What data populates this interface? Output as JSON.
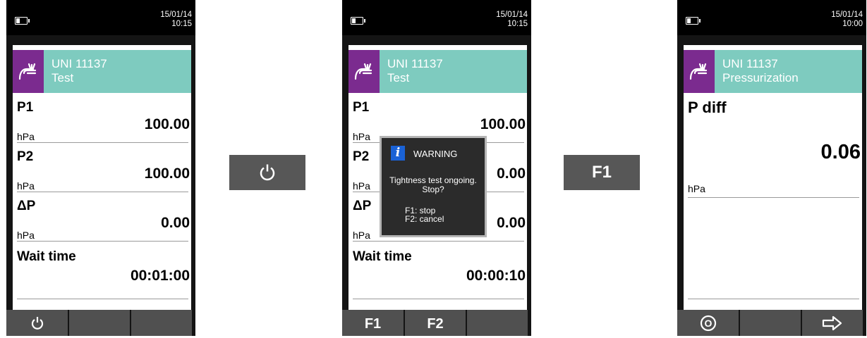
{
  "colors": {
    "header_bg": "#7ecbbf",
    "badge_bg": "#7b2b8f",
    "device_bg": "#141414",
    "key_bg": "#505050",
    "button_bg": "#575757",
    "info_blue": "#1a62d6"
  },
  "screens": [
    {
      "date": "15/01/14",
      "time": "10:15",
      "header": {
        "icon": "gas-leak-icon",
        "line1": "UNI 11137",
        "line2": "Test"
      },
      "rows": [
        {
          "label": "P1",
          "value": "100.00",
          "unit": "hPa"
        },
        {
          "label": "P2",
          "value": "100.00",
          "unit": "hPa"
        },
        {
          "label": "ΔP",
          "value": "0.00",
          "unit": "hPa"
        },
        {
          "label": "Wait time",
          "value": "00:01:00",
          "unit": ""
        }
      ],
      "fkeys": [
        {
          "icon": "power-icon",
          "label": ""
        },
        {
          "label": ""
        },
        {
          "label": ""
        }
      ]
    },
    {
      "date": "15/01/14",
      "time": "10:15",
      "header": {
        "icon": "gas-leak-icon",
        "line1": "UNI 11137",
        "line2": "Test"
      },
      "rows": [
        {
          "label": "P1",
          "value": "100.00",
          "unit": "hPa"
        },
        {
          "label": "P2",
          "value": "0.00",
          "unit": "hPa"
        },
        {
          "label": "ΔP",
          "value": "0.00",
          "unit": "hPa"
        },
        {
          "label": "Wait time",
          "value": "00:00:10",
          "unit": ""
        }
      ],
      "fkeys": [
        {
          "label": "F1"
        },
        {
          "label": "F2"
        },
        {
          "label": ""
        }
      ],
      "dialog": {
        "icon": "info-icon",
        "title": "WARNING",
        "message_line1": "Tightness test ongoing.",
        "message_line2": "Stop?",
        "option1": "F1: stop",
        "option2": "F2: cancel"
      }
    },
    {
      "date": "15/01/14",
      "time": "10:00",
      "header": {
        "icon": "gas-leak-icon",
        "line1": "UNI 11137",
        "line2": "Pressurization"
      },
      "rows": [
        {
          "label": "P diff",
          "value": "0.06",
          "unit": "hPa"
        }
      ],
      "fkeys": [
        {
          "icon": "record-icon",
          "label": ""
        },
        {
          "label": ""
        },
        {
          "icon": "arrow-right-icon",
          "label": ""
        }
      ]
    }
  ],
  "transitions": [
    {
      "icon": "power-icon",
      "label": ""
    },
    {
      "label": "F1"
    }
  ]
}
